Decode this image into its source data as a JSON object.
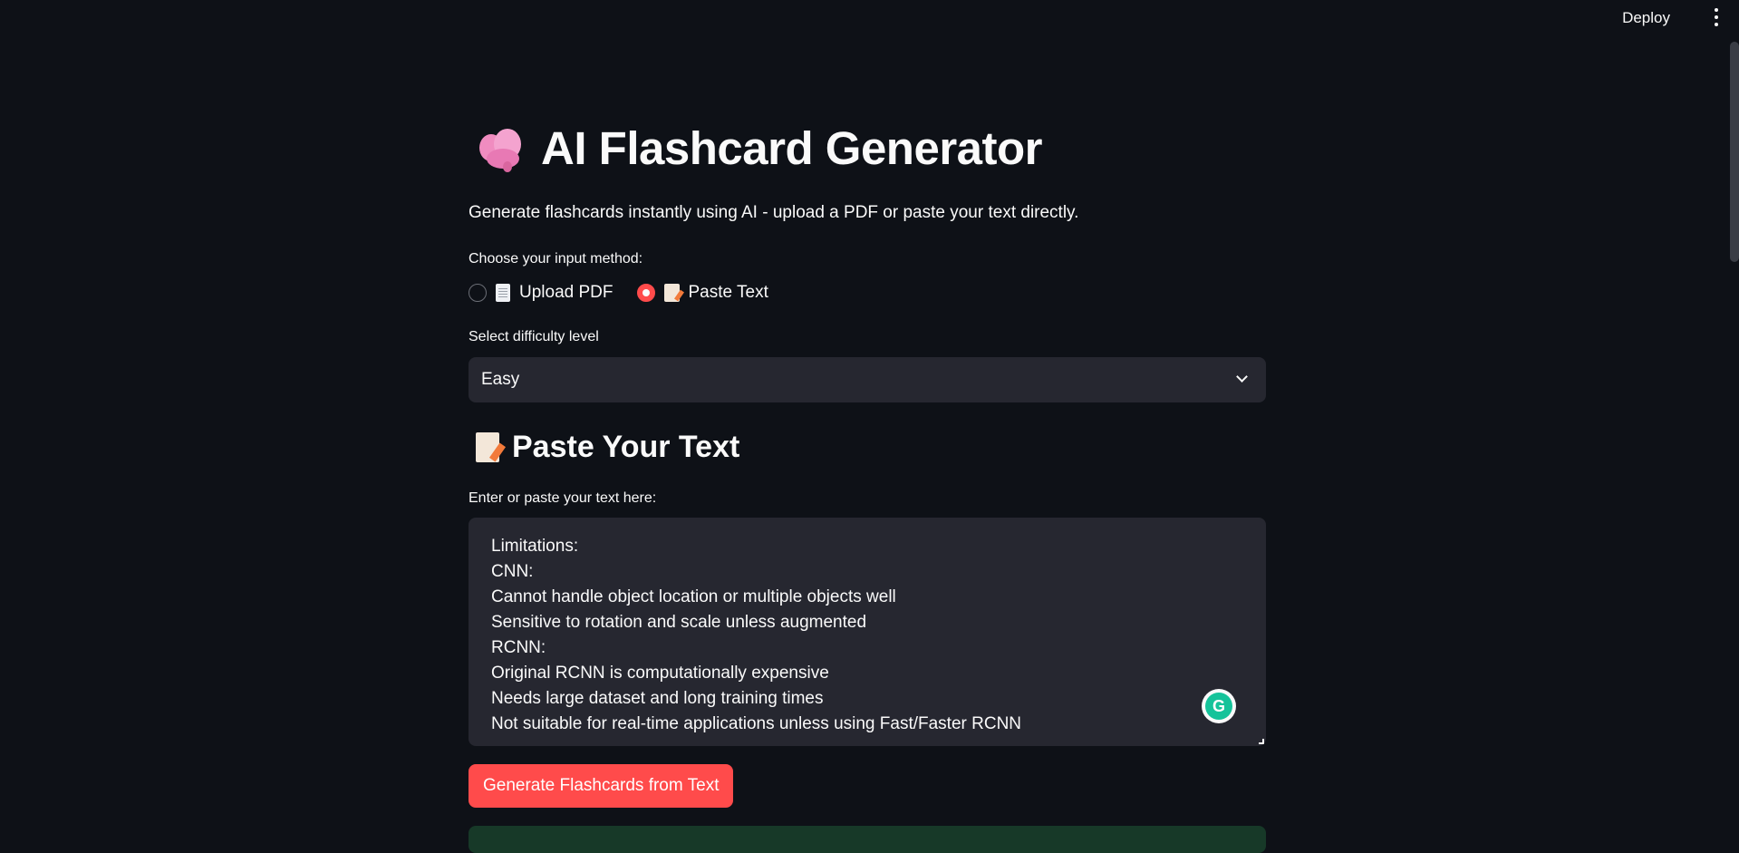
{
  "header": {
    "deploy_label": "Deploy",
    "menu_icon": "vertical-dots-icon"
  },
  "app": {
    "title": "AI Flashcard Generator",
    "title_icon": "brain-icon",
    "subtitle": "Generate flashcards instantly using AI - upload a PDF or paste your text directly."
  },
  "input_method": {
    "label": "Choose your input method:",
    "options": [
      {
        "label": "Upload PDF",
        "icon": "document-icon",
        "selected": false
      },
      {
        "label": "Paste Text",
        "icon": "memo-icon",
        "selected": true
      }
    ]
  },
  "difficulty": {
    "label": "Select difficulty level",
    "selected": "Easy"
  },
  "paste_section": {
    "heading": "Paste Your Text",
    "heading_icon": "memo-icon",
    "textarea_label": "Enter or paste your text here:",
    "lines": [
      "Limitations:",
      "CNN:",
      "Cannot handle object location or multiple objects well",
      "Sensitive to rotation and scale unless augmented",
      "RCNN:",
      "Original RCNN is computationally expensive",
      "Needs large dataset and long training times",
      "Not suitable for real-time applications unless using Fast/Faster RCNN"
    ]
  },
  "generate_button": {
    "label": "Generate Flashcards from Text"
  },
  "colors": {
    "background": "#0e1117",
    "accent": "#ff4b4b",
    "widget": "#262730",
    "success": "#173928"
  }
}
